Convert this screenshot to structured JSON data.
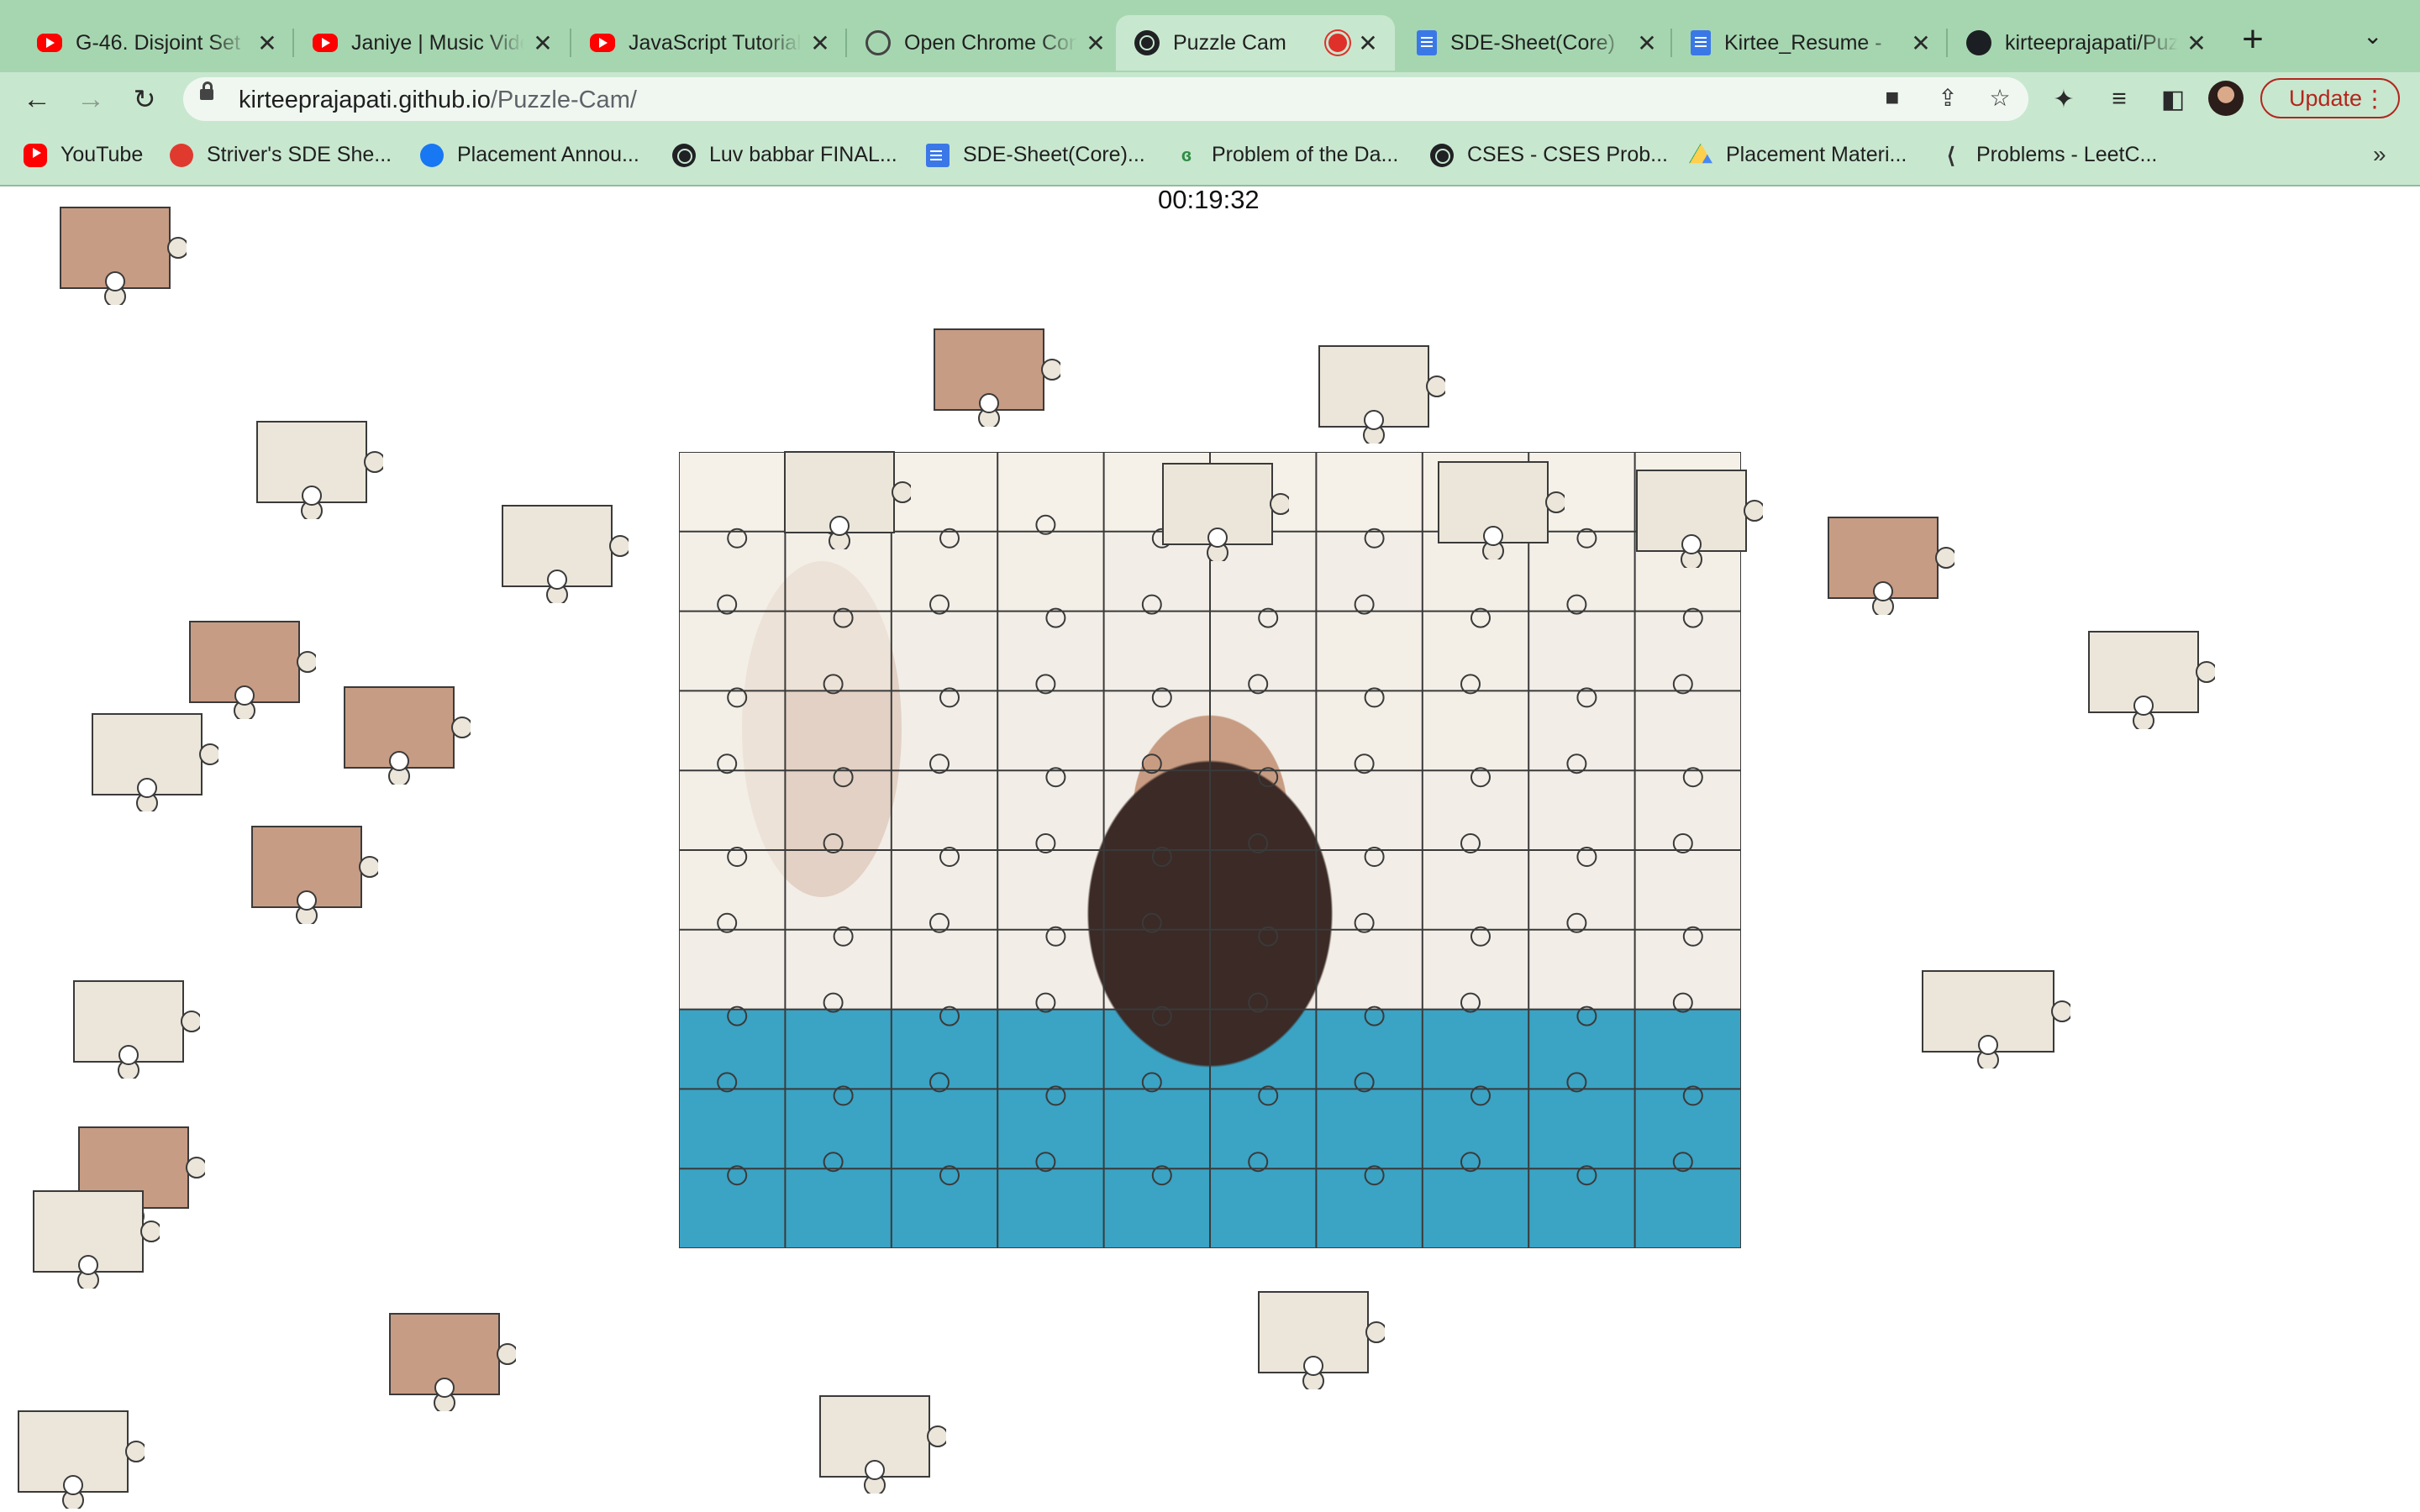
{
  "browser": {
    "tabs": [
      {
        "label": "G-46. Disjoint Set",
        "icon": "youtube-icon",
        "active": false
      },
      {
        "label": "Janiye | Music Video",
        "icon": "youtube-icon",
        "active": false
      },
      {
        "label": "JavaScript Tutorial",
        "icon": "youtube-icon",
        "active": false
      },
      {
        "label": "Open Chrome Console",
        "icon": "openai-icon",
        "active": false
      },
      {
        "label": "Puzzle Cam",
        "icon": "globe-icon",
        "active": true,
        "recording": true
      },
      {
        "label": "SDE-Sheet(Core)",
        "icon": "docs-icon",
        "active": false
      },
      {
        "label": "Kirtee_Resume - ",
        "icon": "docs-icon",
        "active": false
      },
      {
        "label": "kirteeprajapati/Puzzle-Cam",
        "icon": "github-icon",
        "active": false
      }
    ],
    "close_glyph": "✕",
    "new_tab_glyph": "+",
    "tab_search_glyph": "⌄",
    "url": {
      "host": "kirteeprajapati.github.io",
      "path": "/Puzzle-Cam/"
    },
    "update_label": "Update",
    "bookmarks": [
      {
        "label": "YouTube",
        "icon": "youtube-icon"
      },
      {
        "label": "Striver's SDE She...",
        "icon": "striver-icon"
      },
      {
        "label": "Placement Annou...",
        "icon": "facebook-icon"
      },
      {
        "label": "Luv babbar FINAL...",
        "icon": "globe-icon"
      },
      {
        "label": "SDE-Sheet(Core)...",
        "icon": "docs-icon"
      },
      {
        "label": "Problem of the Da...",
        "icon": "gfg-icon"
      },
      {
        "label": "CSES - CSES Prob...",
        "icon": "globe-icon"
      },
      {
        "label": "Placement Materi...",
        "icon": "drive-icon"
      },
      {
        "label": "Problems - LeetC...",
        "icon": "leetcode-icon"
      }
    ],
    "bookmarks_overflow_glyph": "»"
  },
  "puzzle": {
    "timer": "00:19:32",
    "grid_columns": 10,
    "grid_rows": 10,
    "colors": {
      "paper": "#ece6da",
      "outline": "#3a3a3a",
      "skin": "#c79c84",
      "shirt": "#49b1d4",
      "hair": "#2e201c"
    }
  }
}
